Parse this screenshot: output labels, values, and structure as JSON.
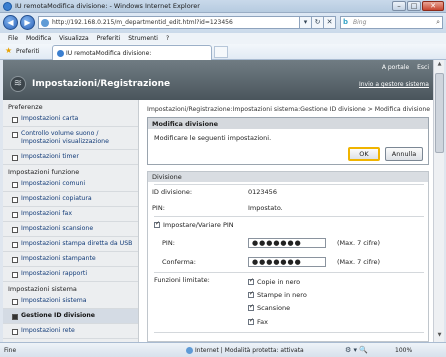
{
  "window": {
    "title": "IU remotaModifica divisione: - Windows Internet Explorer",
    "controls": [
      "minimize",
      "maximize",
      "close"
    ]
  },
  "addressbar": {
    "url": "http://192.168.0.215/m_departmentid_edit.html?id=123456",
    "search_placeholder": "Bing"
  },
  "menu": [
    "File",
    "Modifica",
    "Visualizza",
    "Preferiti",
    "Strumenti",
    "?"
  ],
  "favorites": {
    "label": "Preferiti",
    "tab_title": "IU remotaModifica divisione:"
  },
  "banner": {
    "heading": "Impostazioni/Registrazione",
    "top_links": [
      "A portale",
      "Esci"
    ],
    "back_link": "Invio a gestore sistema",
    "logo_glyph": "≋"
  },
  "sidebar": {
    "sections": [
      {
        "title": "Preferenze",
        "items": [
          {
            "label": "Impostazioni carta",
            "lines": 1
          },
          {
            "label": "Controllo volume suono / Impostazioni visualizzazione",
            "lines": 2
          },
          {
            "label": "Impostazioni timer",
            "lines": 1
          }
        ]
      },
      {
        "title": "Impostazioni funzione",
        "items": [
          {
            "label": "Impostazioni comuni",
            "lines": 1
          },
          {
            "label": "Impostazioni copiatura",
            "lines": 1
          },
          {
            "label": "Impostazioni fax",
            "lines": 1
          },
          {
            "label": "Impostazioni scansione",
            "lines": 1
          },
          {
            "label": "Impostazioni stampa diretta da USB",
            "lines": 2
          },
          {
            "label": "Impostazioni stampante",
            "lines": 1
          },
          {
            "label": "Impostazioni rapporti",
            "lines": 1
          }
        ]
      },
      {
        "title": "Impostazioni sistema",
        "items": [
          {
            "label": "Impostazioni sistema",
            "lines": 1
          },
          {
            "label": "Gestione ID divisione",
            "lines": 1,
            "active": true
          },
          {
            "label": "Impostazioni rete",
            "lines": 1
          },
          {
            "label": "Impostazioni protezione",
            "lines": 1
          }
        ]
      }
    ]
  },
  "main": {
    "breadcrumb": "Impostazioni/Registrazione:Impostazioni sistema:Gestione ID divisione > Modifica divisione",
    "dialog": {
      "title": "Modifica divisione",
      "message": "Modificare le seguenti impostazioni.",
      "ok": "OK",
      "cancel": "Annulla"
    },
    "division": {
      "section_title": "Divisione",
      "id_label": "ID divisione:",
      "id_value": "0123456",
      "pin_label": "PIN:",
      "pin_value": "Impostato.",
      "set_pin_label": "Impostare/Variare PIN",
      "set_pin_checked": true,
      "pin_field_label": "PIN:",
      "pin_field_value": "●●●●●●●",
      "pin_hint": "(Max. 7 cifre)",
      "confirm_label": "Conferma:",
      "confirm_value": "●●●●●●●",
      "confirm_hint": "(Max. 7 cifre)",
      "restricted_label": "Funzioni limitate:",
      "restricted": [
        {
          "label": "Copie in nero",
          "checked": true
        },
        {
          "label": "Stampe in nero",
          "checked": true
        },
        {
          "label": "Scansione",
          "checked": true
        },
        {
          "label": "Fax",
          "checked": true
        }
      ]
    }
  },
  "statusbar": {
    "left": "Fine",
    "zone": "Internet | Modalità protetta: attivata",
    "zoom": "100%"
  }
}
